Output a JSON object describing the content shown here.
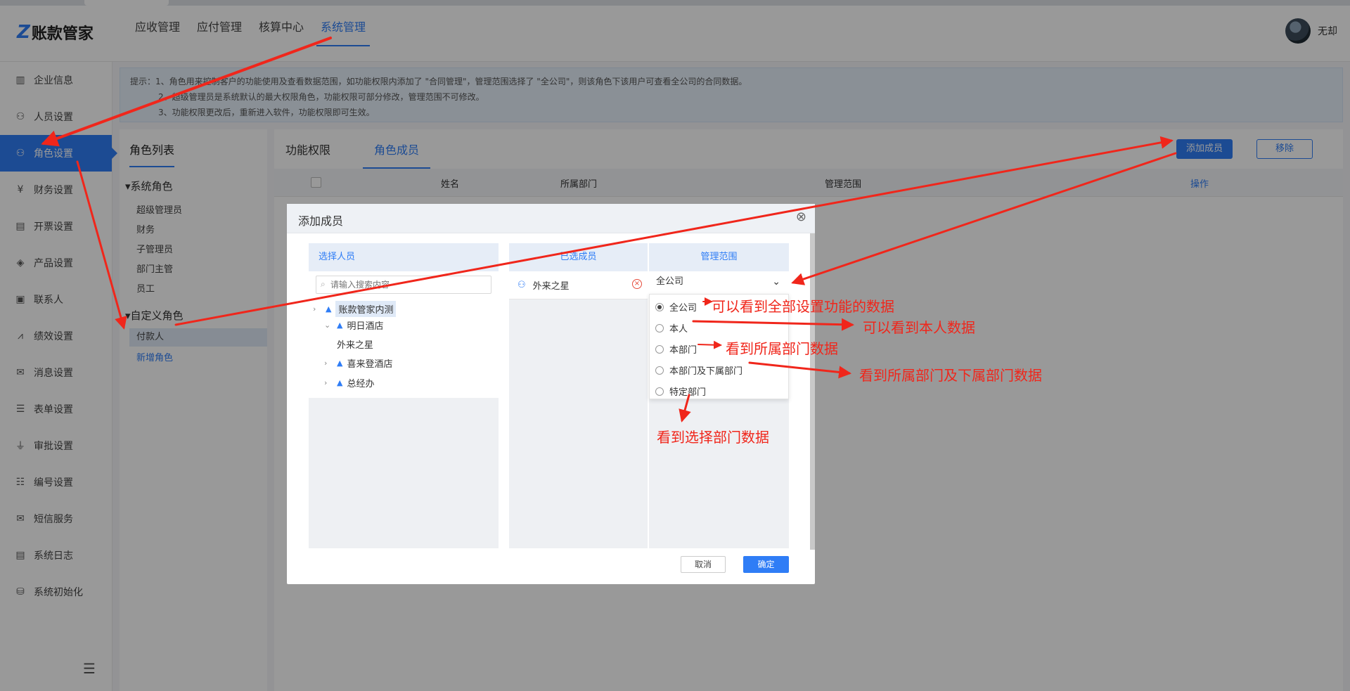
{
  "header": {
    "logo_mark": "Z",
    "logo_text": "账款管家",
    "nav": [
      "应收管理",
      "应付管理",
      "核算中心",
      "系统管理"
    ],
    "active_nav_index": 3,
    "username": "无却"
  },
  "sidebar": {
    "items": [
      {
        "label": "企业信息",
        "icon": "building-icon"
      },
      {
        "label": "人员设置",
        "icon": "person-icon"
      },
      {
        "label": "角色设置",
        "icon": "role-icon"
      },
      {
        "label": "财务设置",
        "icon": "finance-icon"
      },
      {
        "label": "开票设置",
        "icon": "invoice-icon"
      },
      {
        "label": "产品设置",
        "icon": "box-icon"
      },
      {
        "label": "联系人",
        "icon": "contact-icon"
      },
      {
        "label": "绩效设置",
        "icon": "chart-icon"
      },
      {
        "label": "消息设置",
        "icon": "message-icon"
      },
      {
        "label": "表单设置",
        "icon": "form-icon"
      },
      {
        "label": "审批设置",
        "icon": "stamp-icon"
      },
      {
        "label": "编号设置",
        "icon": "list-icon"
      },
      {
        "label": "短信服务",
        "icon": "mail-icon"
      },
      {
        "label": "系统日志",
        "icon": "log-icon"
      },
      {
        "label": "系统初始化",
        "icon": "database-icon"
      }
    ],
    "active_index": 2
  },
  "tip": {
    "line1": "提示：1、角色用来控制客户的功能使用及查看数据范围，如功能权限内添加了 \"合同管理\"，管理范围选择了 \"全公司\"，则该角色下该用户可查看全公司的合同数据。",
    "line2": "2、超级管理员是系统默认的最大权限角色，功能权限可部分修改，管理范围不可修改。",
    "line3": "3、功能权限更改后，重新进入软件，功能权限即可生效。"
  },
  "role_panel": {
    "title": "角色列表",
    "system_group": "系统角色",
    "system_roles": [
      "超级管理员",
      "财务",
      "子管理员",
      "部门主管",
      "员工"
    ],
    "custom_group": "自定义角色",
    "custom_roles": [
      "付款人"
    ],
    "add_role": "新增角色"
  },
  "content": {
    "tabs": [
      "功能权限",
      "角色成员"
    ],
    "active_tab_index": 1,
    "add_button": "添加成员",
    "remove_button": "移除",
    "columns": [
      "姓名",
      "所属部门",
      "管理范围",
      "操作"
    ]
  },
  "modal": {
    "title": "添加成员",
    "close": "⊗",
    "select_header": "选择人员",
    "search_placeholder": "请输入搜索内容",
    "tree": [
      {
        "label": "账款管家内测",
        "arrow": "›",
        "org": true
      },
      {
        "label": "明日酒店",
        "arrow": "⌄",
        "org": true
      },
      {
        "label": "外来之星",
        "arrow": "",
        "org": false
      },
      {
        "label": "喜来登酒店",
        "arrow": "›",
        "org": true
      },
      {
        "label": "总经办",
        "arrow": "›",
        "org": true
      }
    ],
    "selected_header": "已选成员",
    "selected_members": [
      "外来之星"
    ],
    "scope_header": "管理范围",
    "scope_value": "全公司",
    "scope_options": [
      "全公司",
      "本人",
      "本部门",
      "本部门及下属部门",
      "特定部门"
    ],
    "scope_selected_index": 0,
    "cancel": "取消",
    "ok": "确定"
  },
  "annotations": {
    "a1": "可以看到全部设置功能的数据",
    "a2": "可以看到本人数据",
    "a3": "看到所属部门数据",
    "a4": "看到所属部门及下属部门数据",
    "a5": "看到选择部门数据"
  },
  "colors": {
    "accent": "#2f7df6",
    "annotation": "#f0261b"
  }
}
